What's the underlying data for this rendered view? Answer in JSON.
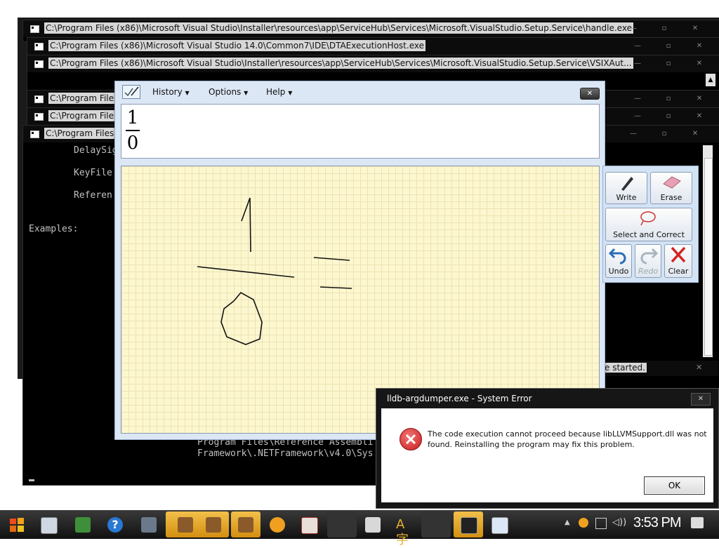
{
  "background_windows": [
    {
      "title": "C:\\Program Files (x86)\\Microsoft Visual Studio\\Installer\\resources\\app\\ServiceHub\\Services\\Microsoft.VisualStudio.Setup.Service\\handle.exe"
    },
    {
      "title": "C:\\Program Files (x86)\\Microsoft Visual Studio 14.0\\Common7\\IDE\\DTAExecutionHost.exe"
    },
    {
      "title": "C:\\Program Files (x86)\\Microsoft Visual Studio\\Installer\\resources\\app\\ServiceHub\\Services\\Microsoft.VisualStudio.Setup.Service\\VSIXAut..."
    },
    {
      "title": "C:\\Program Files"
    },
    {
      "title": "C:\\Program Files"
    },
    {
      "title": "C:\\Program Files"
    }
  ],
  "console": {
    "lines": [
      "DelaySig",
      "KeyFile",
      "Referen",
      "Examples:",
      "Program Files\\Reference Assembli",
      "Framework\\.NETFramework\\v4.0\\Sys"
    ],
    "status_text": "e started."
  },
  "math_panel": {
    "menu": [
      "History",
      "Options",
      "Help"
    ],
    "preview": {
      "numerator": "1",
      "denominator": "0"
    },
    "tools": {
      "write": "Write",
      "erase": "Erase",
      "select_correct": "Select and Correct",
      "undo": "Undo",
      "redo": "Redo",
      "clear": "Clear"
    }
  },
  "error_dialog": {
    "title": "lldb-argdumper.exe - System Error",
    "message_line1": "The code execution cannot proceed because libLLVMSupport.dll was not",
    "message_line2": "found. Reinstalling the program may fix this problem.",
    "ok_label": "OK"
  },
  "taskbar": {
    "clock": "3:53 PM"
  },
  "colors": {
    "pad_background": "#fdf7cf",
    "panel_background": "#dbe7f5",
    "error_red": "#d32f2f",
    "taskbar": "#1c1c1c"
  }
}
